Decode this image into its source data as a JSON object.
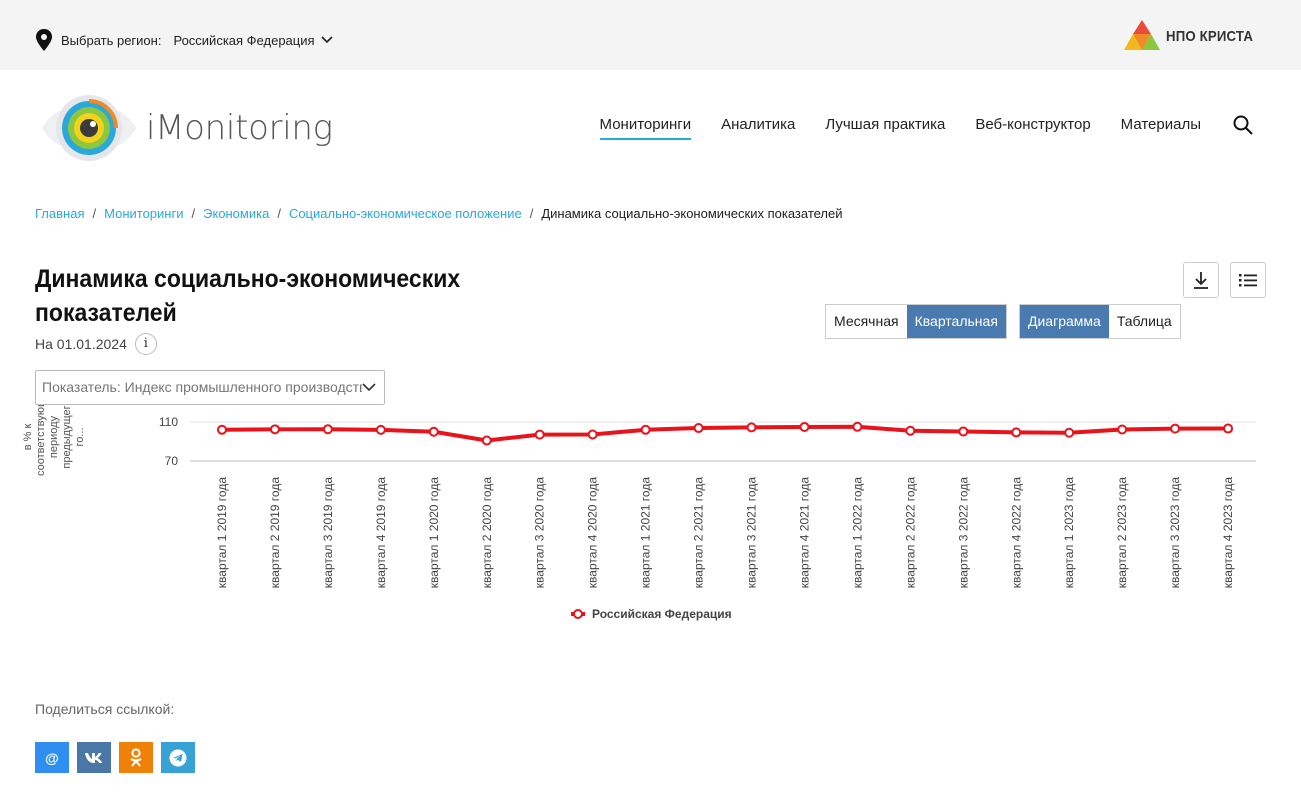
{
  "topbar": {
    "region_label": "Выбрать регион:",
    "region_value": "Российская Федерация",
    "brand": "НПО КРИСТА",
    "icons": [
      "map-pin-icon",
      "chevron-down-icon"
    ]
  },
  "header": {
    "logo_text": "iMonitoring",
    "nav": [
      {
        "label": "Мониторинги",
        "active": true
      },
      {
        "label": "Аналитика",
        "active": false
      },
      {
        "label": "Лучшая практика",
        "active": false
      },
      {
        "label": "Веб-конструктор",
        "active": false
      },
      {
        "label": "Материалы",
        "active": false
      }
    ],
    "search_icon": "search-icon"
  },
  "breadcrumb": {
    "links": [
      "Главная",
      "Мониторинги",
      "Экономика",
      "Социально-экономическое положение"
    ],
    "separator": "/",
    "current": "Динамика социально-экономических показателей"
  },
  "page": {
    "title": "Динамика социально-экономических показателей",
    "date": "На 01.01.2024",
    "info": "i",
    "download_icon": "download-icon",
    "menu_icon": "list-menu-icon"
  },
  "period_toggle": [
    {
      "label": "Месячная",
      "selected": false
    },
    {
      "label": "Квартальная",
      "selected": true
    }
  ],
  "view_toggle": [
    {
      "label": "Диаграмма",
      "selected": true
    },
    {
      "label": "Таблица",
      "selected": false
    }
  ],
  "indicator_select": {
    "value": "Показатель: Индекс промышленного производства"
  },
  "chart_data": {
    "type": "line",
    "ylabel_lines": [
      "в % к",
      "соответствующ",
      "периоду",
      "предыдущег",
      "го..."
    ],
    "y_ticks": [
      "110",
      "70"
    ],
    "ylim": [
      70,
      110
    ],
    "grid": true,
    "categories": [
      "квартал 1 2019 года",
      "квартал 2 2019 года",
      "квартал 3 2019 года",
      "квартал 4 2019 года",
      "квартал 1 2020 года",
      "квартал 2 2020 года",
      "квартал 3 2020 года",
      "квартал 4 2020 года",
      "квартал 1 2021 года",
      "квартал 2 2021 года",
      "квартал 3 2021 года",
      "квартал 4 2021 года",
      "квартал 1 2022 года",
      "квартал 2 2022 года",
      "квартал 3 2022 года",
      "квартал 4 2022 года",
      "квартал 1 2023 года",
      "квартал 2 2023 года",
      "квартал 3 2023 года",
      "квартал 4 2023 года"
    ],
    "series": [
      {
        "name": "Российская Федерация",
        "color": "#e8131b",
        "values": [
          102,
          102.5,
          102.6,
          101.9,
          100,
          91,
          97.1,
          97.2,
          102,
          103.8,
          104.5,
          104.9,
          105.1,
          101,
          100.3,
          99.3,
          99,
          102.3,
          103.2,
          103.3
        ]
      }
    ],
    "legend_position": "bottom-center"
  },
  "share": {
    "label": "Поделиться ссылкой:",
    "buttons": [
      {
        "name": "mail-icon",
        "glyph": "@",
        "color": "#2f8ef0"
      },
      {
        "name": "vk-icon",
        "glyph": "VK",
        "color": "#4a76a8"
      },
      {
        "name": "odnoklassniki-icon",
        "glyph": "ok",
        "color": "#ee8208"
      },
      {
        "name": "telegram-icon",
        "glyph": "tg",
        "color": "#37a2d6"
      }
    ]
  }
}
